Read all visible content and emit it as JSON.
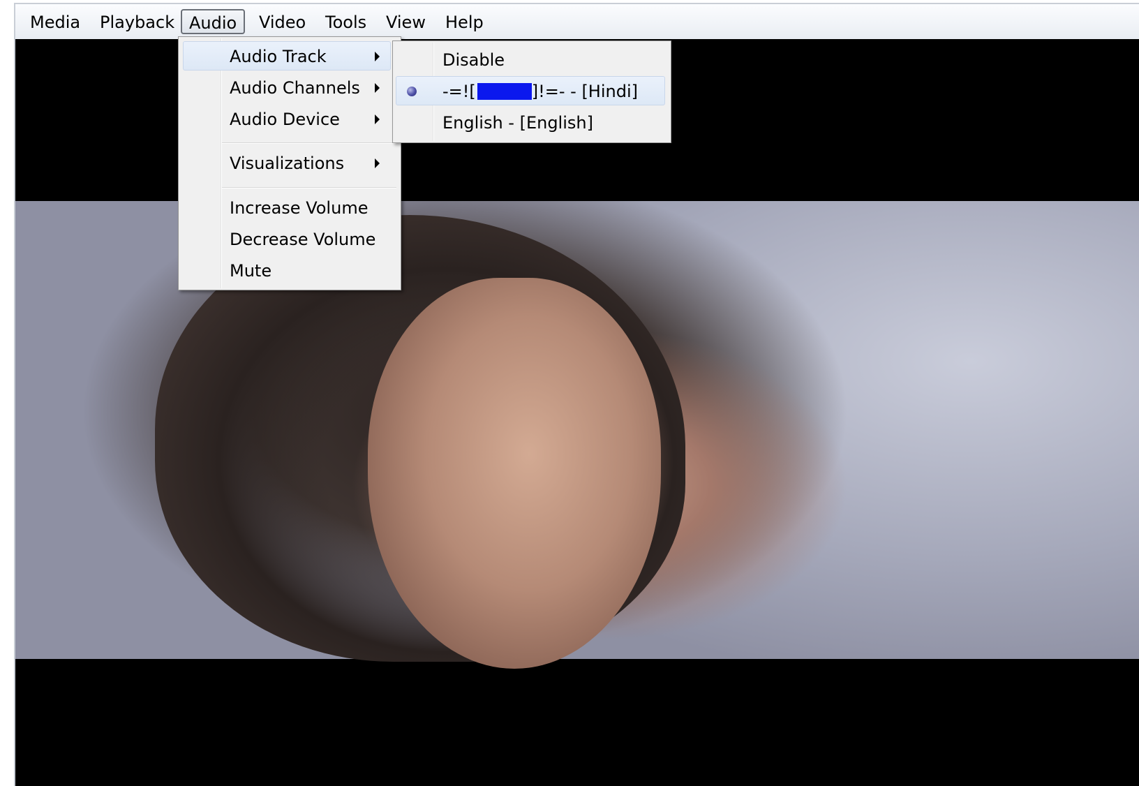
{
  "menubar": {
    "items": [
      {
        "label": "Media"
      },
      {
        "label": "Playback"
      },
      {
        "label": "Audio"
      },
      {
        "label": "Video"
      },
      {
        "label": "Tools"
      },
      {
        "label": "View"
      },
      {
        "label": "Help"
      }
    ],
    "open_item": "Audio"
  },
  "audio_menu": {
    "audio_track": "Audio Track",
    "audio_channels": "Audio Channels",
    "audio_device": "Audio Device",
    "visualizations": "Visualizations",
    "increase_volume": "Increase Volume",
    "decrease_volume": "Decrease Volume",
    "mute": "Mute"
  },
  "audio_track_submenu": {
    "disable": "Disable",
    "track_hindi_prefix": "-=![",
    "track_hindi_suffix": "]!=- - [Hindi]",
    "track_english": "English - [English]",
    "selected": "Hindi"
  },
  "colors": {
    "menu_bg": "#f0f0f0",
    "highlight": "#dde8f6",
    "redaction": "#0b18ee",
    "video_bg": "#000000"
  }
}
